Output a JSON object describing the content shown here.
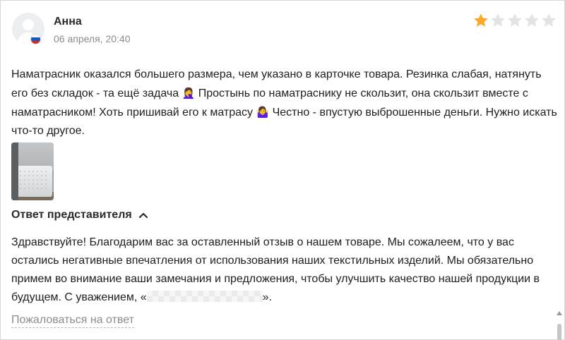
{
  "review": {
    "author": "Анна",
    "date": "06 апреля, 20:40",
    "rating": 1,
    "max_rating": 5,
    "star_filled_color": "#ffa726",
    "star_empty_color": "#e3e3e3",
    "text_part1": "Наматрасник оказался большего размера, чем указано в карточке товара. Резинка слабая, натянуть его без складок - та ещё задача ",
    "emoji1": "🤦‍♀️",
    "text_part2": " Простынь по наматраснику не скользит, она скользит вместе с наматрасником! Хоть пришивай его к матрасу ",
    "emoji2": "🤷‍♀️",
    "text_part3": " Честно - впустую выброшенные деньги. Нужно искать что-то другое."
  },
  "reply": {
    "title": "Ответ представителя",
    "text_main": "Здравствуйте! Благодарим вас за оставленный отзыв о нашем товаре. Мы сожалеем, что у вас остались негативные впечатления от использования наших текстильных изделий. Мы обязательно примем во внимание ваши замечания и предложения, чтобы улучшить качество нашей продукции в будущем. С уважением, «",
    "text_end": "»."
  },
  "actions": {
    "complain_label": "Пожаловаться на ответ"
  },
  "icons": {
    "avatar": "user-placeholder-icon",
    "flag": "russia-flag-icon",
    "star": "star-icon",
    "chevron": "chevron-up-icon"
  }
}
